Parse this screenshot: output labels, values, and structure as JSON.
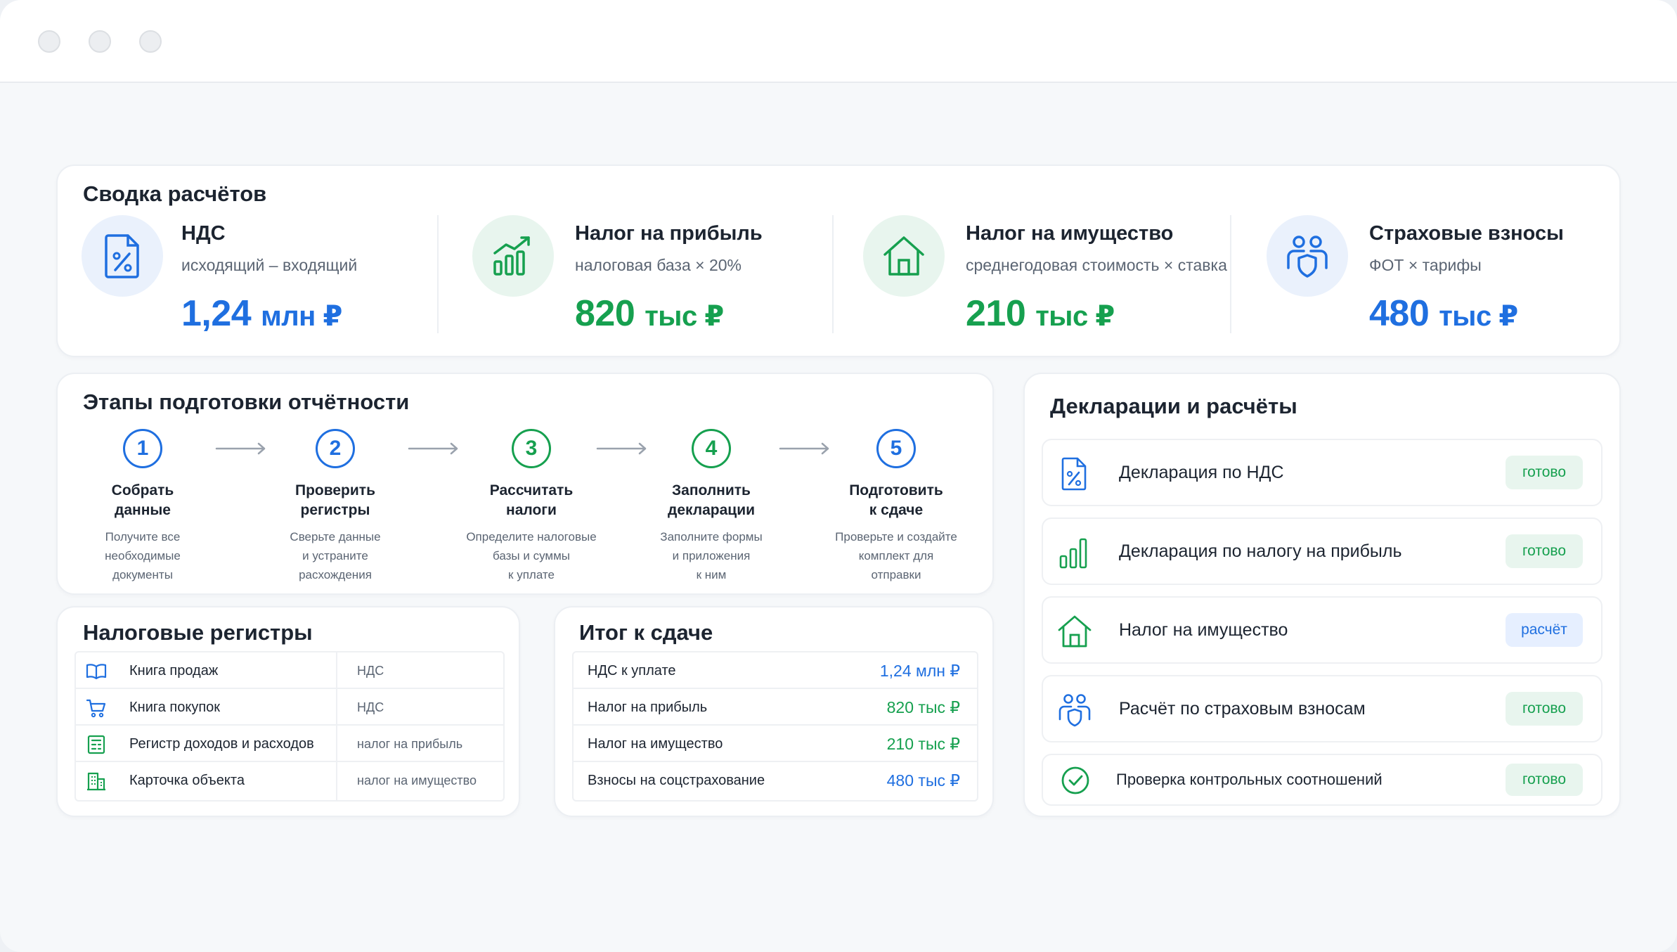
{
  "summary": {
    "title": "Сводка расчётов",
    "items": [
      {
        "name": "НДС",
        "formula": "исходящий – входящий",
        "value": "1,24",
        "unit": "млн ₽",
        "icon": "percent-document-icon",
        "accent": "#1f6fe0"
      },
      {
        "name": "Налог на прибыль",
        "formula": "налоговая база × 20%",
        "value": "820",
        "unit": "тыс ₽",
        "icon": "growth-chart-icon",
        "accent": "#16a04f"
      },
      {
        "name": "Налог на имущество",
        "formula": "среднегодовая стоимость × ставка",
        "value": "210",
        "unit": "тыс ₽",
        "icon": "house-icon",
        "accent": "#16a04f"
      },
      {
        "name": "Страховые взносы",
        "formula": "ФОТ × тарифы",
        "value": "480",
        "unit": "тыс ₽",
        "icon": "people-shield-icon",
        "accent": "#1f6fe0"
      }
    ]
  },
  "steps": {
    "title": "Этапы подготовки отчётности",
    "items": [
      {
        "num": "1",
        "title": "Собрать\nданные",
        "desc": "Получите все\nнеобходимые\nдокументы"
      },
      {
        "num": "2",
        "title": "Проверить\nрегистры",
        "desc": "Сверьте данные\nи устраните\nрасхождения"
      },
      {
        "num": "3",
        "title": "Рассчитать\nналоги",
        "desc": "Определите налоговые\nбазы и суммы\nк уплате"
      },
      {
        "num": "4",
        "title": "Заполнить\nдекларации",
        "desc": "Заполните формы\nи приложения\nк ним"
      },
      {
        "num": "5",
        "title": "Подготовить\nк сдаче",
        "desc": "Проверьте и создайте\nкомплект для\nотправки"
      }
    ]
  },
  "registers": {
    "title": "Налоговые регистры",
    "rows": [
      {
        "name": "Книга продаж",
        "tax": "НДС",
        "icon": "open-book-icon"
      },
      {
        "name": "Книга покупок",
        "tax": "НДС",
        "icon": "cart-icon"
      },
      {
        "name": "Регистр доходов и расходов",
        "tax": "налог на прибыль",
        "icon": "ledger-icon"
      },
      {
        "name": "Карточка объекта",
        "tax": "налог на имущество",
        "icon": "building-icon"
      }
    ]
  },
  "totals": {
    "title": "Итог к сдаче",
    "rows": [
      {
        "name": "НДС к уплате",
        "amount": "1,24 млн ₽",
        "color": "#1f6fe0"
      },
      {
        "name": "Налог на прибыль",
        "amount": "820 тыс ₽",
        "color": "#16a04f"
      },
      {
        "name": "Налог на имущество",
        "amount": "210 тыс ₽",
        "color": "#16a04f"
      },
      {
        "name": "Взносы на соцстрахование",
        "amount": "480 тыс ₽",
        "color": "#1f6fe0"
      }
    ]
  },
  "declarations": {
    "title": "Декларации и расчёты",
    "rows": [
      {
        "label": "Декларация по НДС",
        "status": "готово",
        "kind": "ok",
        "icon": "percent-document-icon"
      },
      {
        "label": "Декларация по налогу на прибыль",
        "status": "готово",
        "kind": "ok",
        "icon": "bar-chart-icon"
      },
      {
        "label": "Налог на имущество",
        "status": "расчёт",
        "kind": "calc",
        "icon": "house-icon"
      },
      {
        "label": "Расчёт по страховым взносам",
        "status": "готово",
        "kind": "ok",
        "icon": "people-shield-icon"
      },
      {
        "label": "Проверка контрольных соотношений",
        "status": "готово",
        "kind": "ok",
        "icon": "check-circle-icon"
      }
    ]
  }
}
